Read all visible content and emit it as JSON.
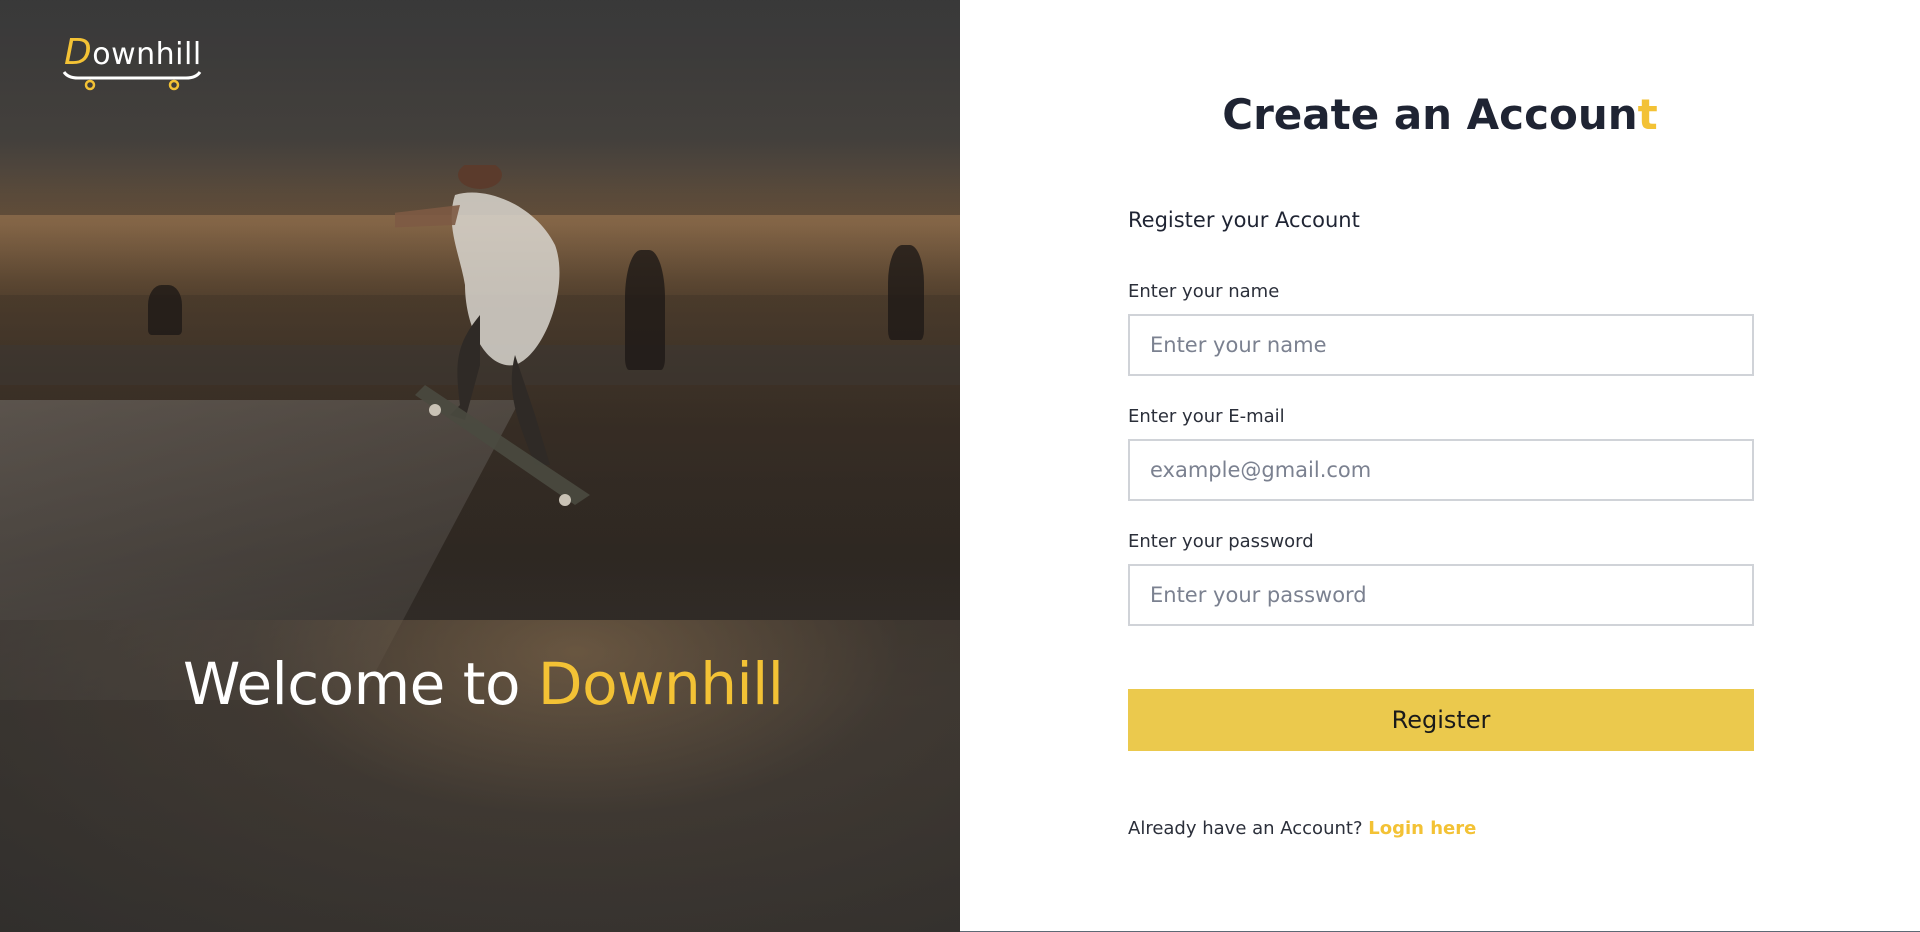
{
  "brand": {
    "logo_first": "D",
    "logo_rest": "ownhil",
    "logo_end": "l",
    "accent_color": "#f3c235",
    "button_color": "#ebc94d"
  },
  "hero": {
    "welcome_prefix": "Welcome to ",
    "welcome_accent": "Downhill"
  },
  "form": {
    "title_main": "Create an Accoun",
    "title_last": "t",
    "subtitle": "Register your Account",
    "fields": [
      {
        "label": "Enter your name",
        "placeholder": "Enter your name",
        "value": ""
      },
      {
        "label": "Enter your E-mail",
        "placeholder": "example@gmail.com",
        "value": ""
      },
      {
        "label": "Enter your password",
        "placeholder": "Enter your password",
        "value": ""
      }
    ],
    "register_label": "Register",
    "login_prompt": "Already have an Account? ",
    "login_link": "Login here"
  },
  "icons": {
    "skateboard": "skateboard-icon"
  }
}
